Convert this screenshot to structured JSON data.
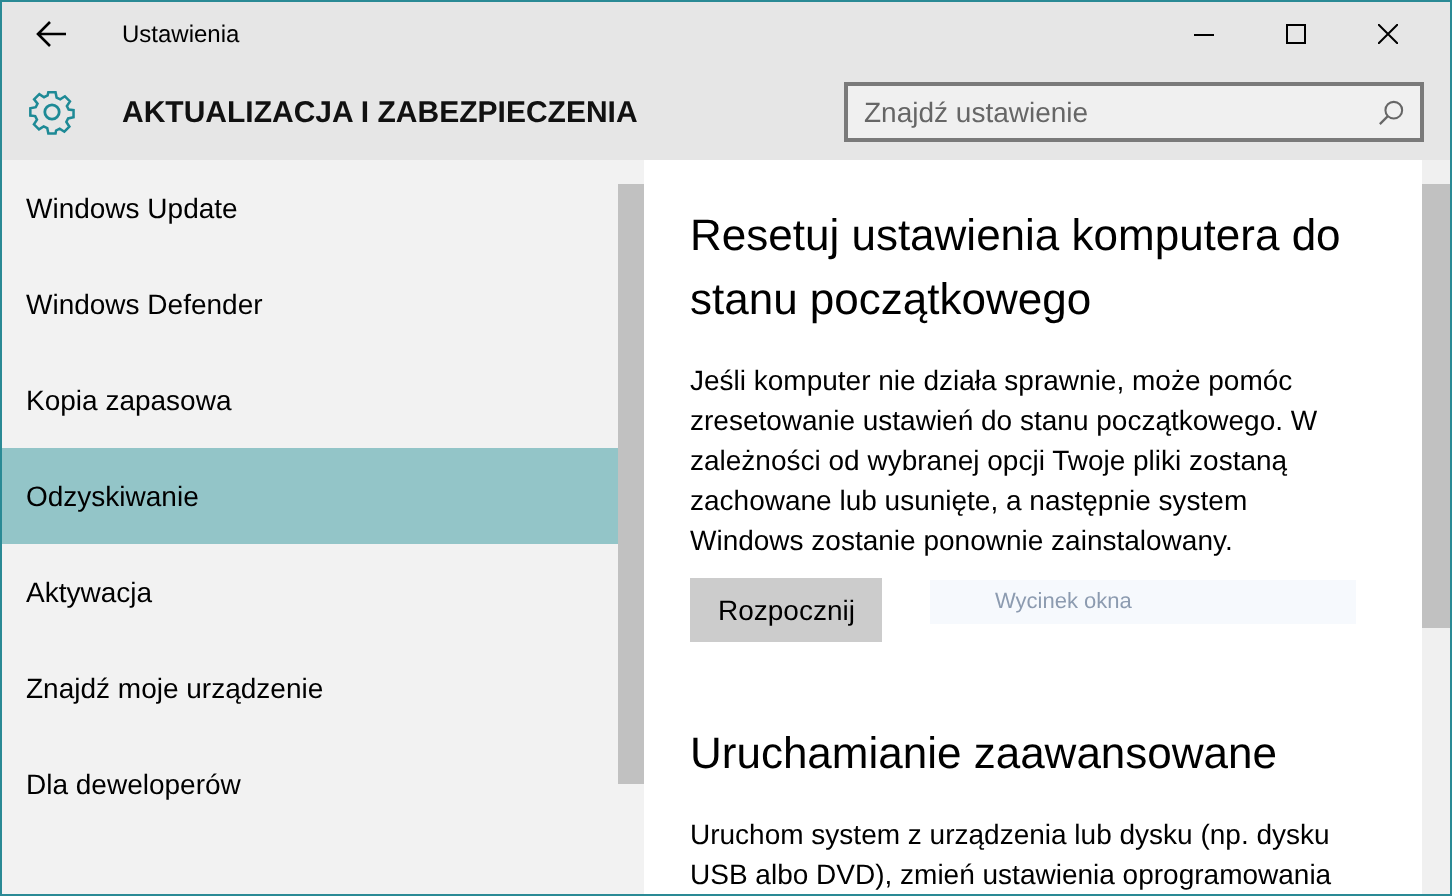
{
  "window": {
    "title": "Ustawienia"
  },
  "header": {
    "title": "AKTUALIZACJA I ZABEZPIECZENIA",
    "search": {
      "placeholder": "Znajdź ustawienie"
    }
  },
  "sidebar": {
    "items": [
      {
        "label": "Windows Update",
        "selected": false
      },
      {
        "label": "Windows Defender",
        "selected": false
      },
      {
        "label": "Kopia zapasowa",
        "selected": false
      },
      {
        "label": "Odzyskiwanie",
        "selected": true
      },
      {
        "label": "Aktywacja",
        "selected": false
      },
      {
        "label": "Znajdź moje urządzenie",
        "selected": false
      },
      {
        "label": "Dla deweloperów",
        "selected": false
      }
    ]
  },
  "sections": [
    {
      "heading": "Resetuj ustawienia komputera do stanu początkowego",
      "text": "Jeśli komputer nie działa sprawnie, może pomóc zresetowanie ustawień do stanu początkowego. W zależności od wybranej opcji Twoje pliki zostaną zachowane lub usunięte, a następnie system Windows zostanie ponownie zainstalowany.",
      "button": "Rozpocznij",
      "overlay": "Wycinek okna"
    },
    {
      "heading": "Uruchamianie zaawansowane",
      "text": "Uruchom system z urządzenia lub dysku (np. dysku USB albo DVD), zmień ustawienia oprogramowania"
    }
  ]
}
